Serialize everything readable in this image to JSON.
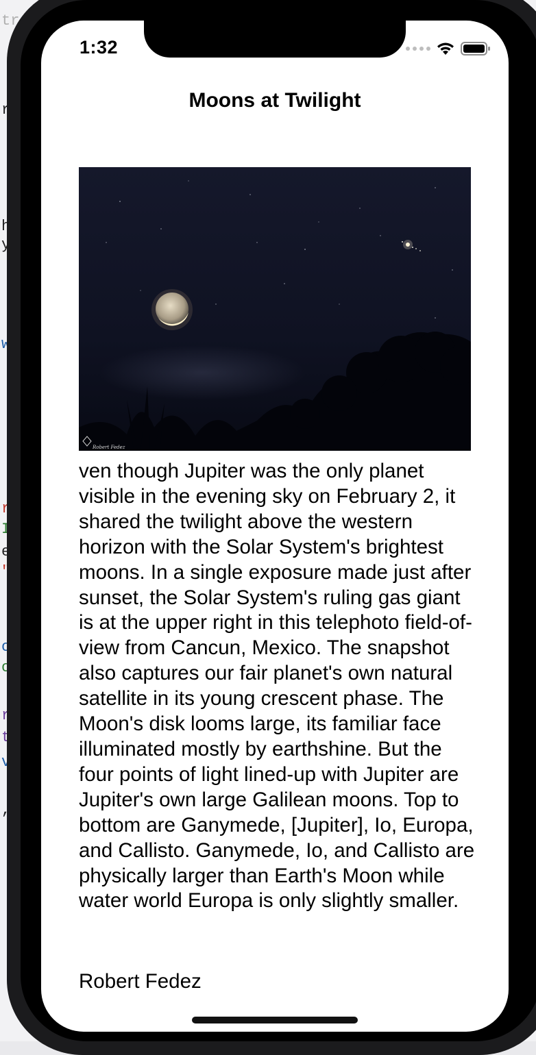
{
  "status_bar": {
    "time": "1:32",
    "icons": [
      "signal-dots-icon",
      "wifi-icon",
      "battery-icon"
    ]
  },
  "nav": {
    "title": "Moons at Twilight"
  },
  "photo": {
    "watermark": "Robert Fedez"
  },
  "article": {
    "explanation": "ven though Jupiter was the only planet visible in the evening sky on February 2, it shared the twilight above the western horizon with the Solar System's brightest moons. In a single exposure made just after sunset, the Solar System's ruling gas giant is at the upper right in this telephoto field-of-view from Cancun, Mexico. The snapshot also captures our fair planet's own natural satellite in its young crescent phase. The Moon's disk looms large, its familiar face illuminated mostly by earthshine. But the four points of light lined-up with Jupiter are Jupiter's own large Galilean moons. Top to bottom are Ganymede, [Jupiter], Io, Europa, and Callisto. Ganymede, Io, and Callisto are physically larger than Earth's Moon while water world Europa is only slightly smaller.",
    "credit": "Robert Fedez"
  },
  "background_fragments": [
    "troll",
    "r",
    "h",
    "y.",
    "w",
    "r",
    "I",
    "e",
    "\"",
    "c",
    "c",
    "r",
    "t",
    "v",
    ","
  ],
  "colors": {
    "screen_background": "#ffffff",
    "device_frame": "#1b1b1d",
    "night_sky": "#0d0f1f"
  }
}
